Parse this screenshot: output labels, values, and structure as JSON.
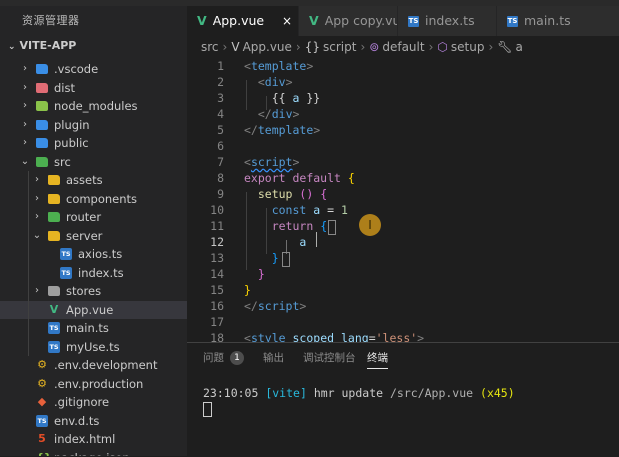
{
  "sidebar": {
    "title": "资源管理器",
    "root": "VITE-APP",
    "items": [
      {
        "label": ".vscode",
        "icon": "vscode-folder-icon",
        "color": "#3a8ee6"
      },
      {
        "label": "dist",
        "icon": "dist-folder-icon",
        "color": "#e06c75"
      },
      {
        "label": "node_modules",
        "icon": "node-modules-folder-icon",
        "color": "#8bc34a"
      },
      {
        "label": "plugin",
        "icon": "plugin-folder-icon",
        "color": "#3a8ee6"
      },
      {
        "label": "public",
        "icon": "public-folder-icon",
        "color": "#3a8ee6"
      },
      {
        "label": "src",
        "icon": "src-folder-icon",
        "color": "#4caf50"
      },
      {
        "label": "assets",
        "icon": "assets-folder-icon",
        "color": "#e6b422"
      },
      {
        "label": "components",
        "icon": "components-folder-icon",
        "color": "#e6b422"
      },
      {
        "label": "router",
        "icon": "router-folder-icon",
        "color": "#4caf50"
      },
      {
        "label": "server",
        "icon": "server-folder-icon",
        "color": "#e6b422"
      },
      {
        "label": "axios.ts",
        "icon": "typescript-file-icon",
        "color": "#3178c6"
      },
      {
        "label": "index.ts",
        "icon": "typescript-file-icon",
        "color": "#3178c6"
      },
      {
        "label": "stores",
        "icon": "stores-folder-icon",
        "color": "#9e9e9e"
      },
      {
        "label": "App.vue",
        "icon": "vue-file-icon",
        "color": "#42b883"
      },
      {
        "label": "main.ts",
        "icon": "typescript-file-icon",
        "color": "#3178c6"
      },
      {
        "label": "myUse.ts",
        "icon": "typescript-file-icon",
        "color": "#3178c6"
      },
      {
        "label": ".env.development",
        "icon": "env-file-icon",
        "color": "#e6b422"
      },
      {
        "label": ".env.production",
        "icon": "env-file-icon",
        "color": "#e6b422"
      },
      {
        "label": ".gitignore",
        "icon": "git-file-icon",
        "color": "#e8613b"
      },
      {
        "label": "env.d.ts",
        "icon": "typescript-def-file-icon",
        "color": "#3178c6"
      },
      {
        "label": "index.html",
        "icon": "html-file-icon",
        "color": "#e44d26"
      },
      {
        "label": "package.json",
        "icon": "json-file-icon",
        "color": "#8bc34a"
      }
    ]
  },
  "tabs": [
    {
      "label": "App.vue",
      "icon": "vue-file-icon",
      "active": true
    },
    {
      "label": "App copy.vue",
      "icon": "vue-file-icon",
      "active": false
    },
    {
      "label": "index.ts",
      "icon": "typescript-file-icon",
      "active": false
    },
    {
      "label": "main.ts",
      "icon": "typescript-file-icon",
      "active": false
    }
  ],
  "tab_close_glyph": "×",
  "breadcrumb": [
    "src",
    "App.vue",
    "script",
    "default",
    "setup",
    "a"
  ],
  "editor": {
    "line_numbers": [
      "1",
      "2",
      "3",
      "4",
      "5",
      "6",
      "7",
      "8",
      "9",
      "10",
      "11",
      "12",
      "13",
      "14",
      "15",
      "16",
      "17",
      "18"
    ],
    "current_line": "12",
    "lines": [
      {
        "parts": [
          [
            "<",
            "t-punc"
          ],
          [
            "template",
            "t-tag"
          ],
          [
            ">",
            "t-punc"
          ]
        ]
      },
      {
        "parts": [
          [
            "  ",
            ""
          ],
          [
            "<",
            "t-punc"
          ],
          [
            "div",
            "t-tag"
          ],
          [
            ">",
            "t-punc"
          ]
        ]
      },
      {
        "parts": [
          [
            "    ",
            ""
          ],
          [
            "{{",
            "t-def"
          ],
          [
            " ",
            ""
          ],
          [
            "a",
            "t-var"
          ],
          [
            " ",
            ""
          ],
          [
            "}}",
            "t-def"
          ]
        ]
      },
      {
        "parts": [
          [
            "  ",
            ""
          ],
          [
            "</",
            "t-punc"
          ],
          [
            "div",
            "t-tag"
          ],
          [
            ">",
            "t-punc"
          ]
        ]
      },
      {
        "parts": [
          [
            "</",
            "t-punc"
          ],
          [
            "template",
            "t-tag"
          ],
          [
            ">",
            "t-punc"
          ]
        ]
      },
      {
        "parts": []
      },
      {
        "parts": [
          [
            "<",
            "t-punc"
          ],
          [
            "script",
            "t-tag squig"
          ],
          [
            ">",
            "t-punc"
          ]
        ]
      },
      {
        "parts": [
          [
            "export",
            "t-kw"
          ],
          [
            " ",
            ""
          ],
          [
            "default",
            "t-kw"
          ],
          [
            " ",
            ""
          ],
          [
            "{",
            "t-br"
          ]
        ]
      },
      {
        "parts": [
          [
            "  ",
            ""
          ],
          [
            "setup",
            "t-fn"
          ],
          [
            " ",
            ""
          ],
          [
            "()",
            "t-br2"
          ],
          [
            " ",
            ""
          ],
          [
            "{",
            "t-br2"
          ]
        ]
      },
      {
        "parts": [
          [
            "    ",
            ""
          ],
          [
            "const",
            "t-tag"
          ],
          [
            " ",
            ""
          ],
          [
            "a",
            "t-var"
          ],
          [
            " = ",
            "t-def"
          ],
          [
            "1",
            "t-num"
          ]
        ]
      },
      {
        "parts": [
          [
            "    ",
            ""
          ],
          [
            "return",
            "t-kw"
          ],
          [
            " ",
            ""
          ],
          [
            "{",
            "t-br3"
          ]
        ]
      },
      {
        "parts": [
          [
            "        ",
            ""
          ],
          [
            "a",
            "t-var"
          ]
        ]
      },
      {
        "parts": [
          [
            "    ",
            ""
          ],
          [
            "}",
            "t-br3"
          ]
        ]
      },
      {
        "parts": [
          [
            "  ",
            ""
          ],
          [
            "}",
            "t-br2"
          ]
        ]
      },
      {
        "parts": [
          [
            "}",
            "t-br"
          ]
        ]
      },
      {
        "parts": [
          [
            "</",
            "t-punc"
          ],
          [
            "script",
            "t-tag"
          ],
          [
            ">",
            "t-punc"
          ]
        ]
      },
      {
        "parts": []
      },
      {
        "parts": [
          [
            "<",
            "t-punc"
          ],
          [
            "style",
            "t-tag"
          ],
          [
            " ",
            ""
          ],
          [
            "scoped",
            "t-attr"
          ],
          [
            " ",
            ""
          ],
          [
            "lang",
            "t-attr"
          ],
          [
            "=",
            "t-def"
          ],
          [
            "'less'",
            "t-str"
          ],
          [
            ">",
            "t-punc"
          ]
        ]
      }
    ],
    "pointer_glyph": "I"
  },
  "panel": {
    "tabs": [
      {
        "label": "问题",
        "badge": "1",
        "active": false
      },
      {
        "label": "输出",
        "active": false
      },
      {
        "label": "调试控制台",
        "active": false
      },
      {
        "label": "终端",
        "active": true
      }
    ],
    "terminal": {
      "time": "23:10:05",
      "tag": "[vite]",
      "message": "hmr update",
      "path": "/src/App.vue",
      "count": "(x45)"
    }
  },
  "colors": {
    "accent_vue": "#42b883",
    "accent_ts": "#3178c6",
    "editor_bg": "#1e1e1e",
    "sidebar_bg": "#252526"
  }
}
